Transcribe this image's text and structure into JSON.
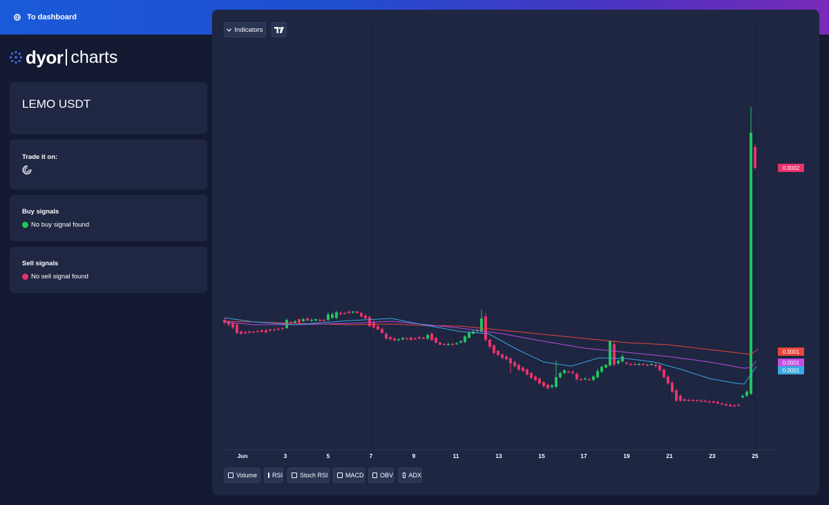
{
  "topbar": {
    "dashboard_link": "To dashboard",
    "gradient_colors": [
      "#1a5ad8",
      "#4a33c0",
      "#7a2ab8"
    ]
  },
  "logo": {
    "word": "dyor",
    "suffix": "charts"
  },
  "pair_card": {
    "title": "LEMO USDT"
  },
  "trade_card": {
    "title": "Trade it on:",
    "exchange_icon": "exchange-logo-icon"
  },
  "buy_card": {
    "title": "Buy signals",
    "status": "No buy signal found",
    "status_color": "#22c55e"
  },
  "sell_card": {
    "title": "Sell signals",
    "status": "No sell signal found",
    "status_color": "#e8336b"
  },
  "chart": {
    "toolbar": {
      "indicators_label": "Indicators",
      "tradingview_icon": "tradingview-icon"
    },
    "x_ticks": [
      "Jun",
      "3",
      "5",
      "7",
      "9",
      "11",
      "13",
      "15",
      "17",
      "19",
      "21",
      "23",
      "25"
    ],
    "price_tags": [
      {
        "label": "0.0002",
        "color": "#e8336b"
      },
      {
        "label": "0.0001",
        "color": "#e8453c"
      },
      {
        "label": "0.0001",
        "color": "#c24de0"
      },
      {
        "label": "0.0001",
        "color": "#3ba9e0"
      }
    ],
    "colors": {
      "up": "#22c55e",
      "down": "#e8336b",
      "ma_long": "#e8453c",
      "ma_mid": "#b84de0",
      "ma_short": "#3ba9e0"
    },
    "toggles": [
      "Volume",
      "RSI",
      "Stoch RSI",
      "MACD",
      "OBV",
      "ADX"
    ]
  }
}
